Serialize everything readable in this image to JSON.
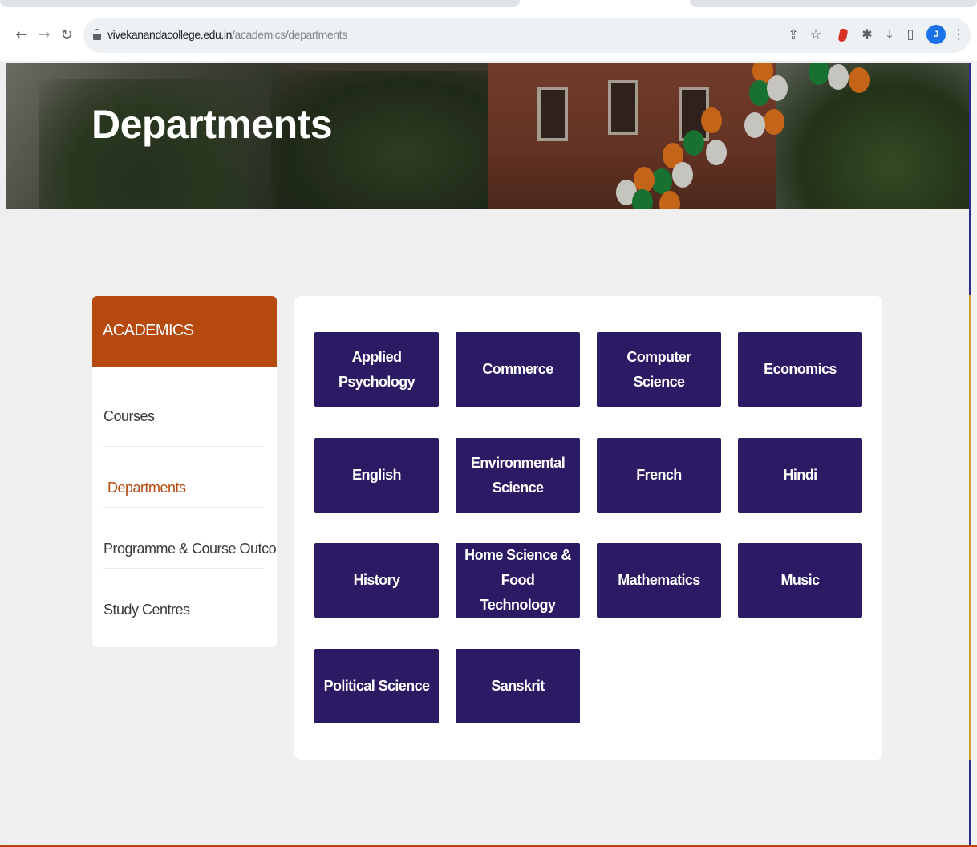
{
  "browser": {
    "url_domain": "vivekanandacollege.edu.in",
    "url_path": "/academics/departments",
    "icons": {
      "back": "back-arrow-icon",
      "forward": "forward-arrow-icon",
      "reload": "reload-icon",
      "share": "share-icon",
      "bookmark": "star-icon",
      "extensions": "puzzle-icon",
      "download": "download-icon",
      "sidepanel": "side-panel-icon",
      "menu": "kebab-menu-icon"
    },
    "avatar_initial": "J"
  },
  "hero": {
    "title": "Departments"
  },
  "sidebar": {
    "heading": "ACADEMICS",
    "items": [
      {
        "label": "Courses",
        "active": false
      },
      {
        "label": "Departments",
        "active": true
      },
      {
        "label": "Programme & Course Outcome",
        "active": false
      },
      {
        "label": "Study Centres",
        "active": false
      }
    ]
  },
  "departments": [
    "Applied Psychology",
    "Commerce",
    "Computer Science",
    "Economics",
    "English",
    "Environmental Science",
    "French",
    "Hindi",
    "History",
    "Home Science & Food Technology",
    "Mathematics",
    "Music",
    "Political Science",
    "Sanskrit"
  ],
  "colors": {
    "accent": "#b5490e",
    "dept_button": "#2b1a64",
    "page_bg": "#efefef"
  }
}
